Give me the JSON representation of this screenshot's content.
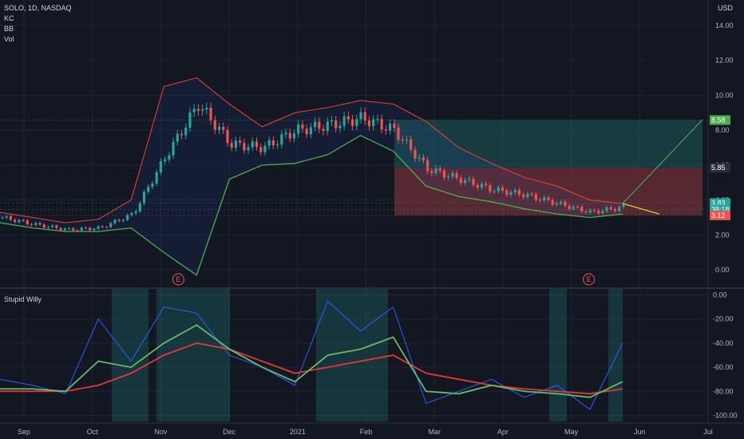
{
  "header": {
    "symbol_line": "SOLO, 1D, NASDAQ",
    "indicators": [
      "KC",
      "BB",
      "Vol"
    ],
    "currency": "USD"
  },
  "oscillator": {
    "title": "Stupid Willy"
  },
  "colors": {
    "bg": "#131722",
    "grid": "#1f2433",
    "up": "#26a69a",
    "down": "#ef5350",
    "bb_upper": "#f44336",
    "bb_lower": "#4caf50",
    "osc_blue": "#2962ff",
    "osc_green": "#66bb6a",
    "osc_red": "#e53935"
  },
  "chart_data": [
    {
      "type": "candlestick",
      "title": "SOLO, 1D, NASDAQ",
      "x_ticks": [
        "Sep",
        "Oct",
        "Nov",
        "Dec",
        "2021",
        "Feb",
        "Mar",
        "Apr",
        "May",
        "Jun",
        "Jul"
      ],
      "y_ticks": [
        0.0,
        2.0,
        4.0,
        6.0,
        8.0,
        10.0,
        12.0,
        14.0
      ],
      "ylim": [
        -1,
        15
      ],
      "price_labels": [
        {
          "text": "8.58",
          "value": 8.58,
          "color": "#4caf50"
        },
        {
          "text": "5.85",
          "value": 5.85,
          "color": "#2a2e39"
        },
        {
          "text": "3.83",
          "value": 3.83,
          "color": "#26a69a"
        },
        {
          "text": "38:18",
          "value": 3.45,
          "color": "#26a69a"
        },
        {
          "text": "3.12",
          "value": 3.12,
          "color": "#ef5350"
        }
      ],
      "earnings_markers": [
        {
          "text": "E",
          "month": "Nov"
        },
        {
          "text": "E",
          "month": "May"
        }
      ],
      "price_series": {
        "months": [
          "Aug end",
          "Sep",
          "Oct",
          "Oct mid",
          "Nov",
          "Nov mid",
          "Nov late",
          "Dec",
          "Dec mid",
          "2021",
          "Jan mid",
          "Feb",
          "Feb mid",
          "Mar",
          "Mar mid",
          "Apr",
          "Apr mid",
          "May",
          "May mid",
          "May end"
        ],
        "close": [
          3.0,
          2.6,
          2.3,
          2.4,
          3.2,
          6.5,
          9.5,
          7.2,
          7.0,
          8.0,
          8.3,
          8.7,
          8.0,
          5.8,
          5.2,
          4.6,
          4.3,
          3.8,
          3.3,
          3.6
        ]
      },
      "bollinger_upper": [
        3.3,
        3.0,
        2.7,
        2.9,
        4.0,
        10.5,
        11.0,
        9.5,
        8.2,
        9.0,
        9.3,
        9.7,
        9.5,
        8.5,
        7.0,
        6.1,
        5.3,
        4.8,
        4.0,
        3.8
      ],
      "bollinger_lower": [
        2.7,
        2.4,
        2.2,
        2.2,
        2.4,
        1.0,
        -0.3,
        5.2,
        6.0,
        6.1,
        6.6,
        7.7,
        6.8,
        4.8,
        4.2,
        3.9,
        3.5,
        3.2,
        3.0,
        3.2
      ],
      "trade_box": {
        "entry": 5.85,
        "target": 8.58,
        "stop": 3.12
      }
    },
    {
      "type": "line",
      "title": "Stupid Willy",
      "y_ticks": [
        0.0,
        -20.0,
        -40.0,
        -60.0,
        -80.0,
        -100.0
      ],
      "ylim": [
        -105,
        5
      ],
      "x": [
        "Aug end",
        "Sep",
        "Oct",
        "Oct mid",
        "Nov",
        "Nov mid",
        "Nov late",
        "Dec",
        "Dec mid",
        "2021",
        "Jan mid",
        "Feb",
        "Feb mid",
        "Mar",
        "Mar mid",
        "Apr",
        "Apr mid",
        "May",
        "May mid",
        "May end"
      ],
      "series": [
        {
          "name": "",
          "color": "#2962ff",
          "values": [
            -70,
            -75,
            -82,
            -20,
            -55,
            -10,
            -15,
            -50,
            -60,
            -75,
            -5,
            -30,
            -10,
            -90,
            -80,
            -70,
            -85,
            -75,
            -95,
            -40
          ]
        },
        {
          "name": "",
          "color": "#e53935",
          "values": [
            -80,
            -80,
            -80,
            -75,
            -65,
            -50,
            -40,
            -45,
            -55,
            -65,
            -60,
            -55,
            -50,
            -65,
            -70,
            -75,
            -78,
            -80,
            -82,
            -78
          ]
        },
        {
          "name": "",
          "color": "#66bb6a",
          "values": [
            -78,
            -78,
            -80,
            -55,
            -60,
            -40,
            -25,
            -45,
            -60,
            -72,
            -50,
            -45,
            -35,
            -80,
            -82,
            -75,
            -80,
            -82,
            -85,
            -72
          ]
        }
      ]
    }
  ]
}
